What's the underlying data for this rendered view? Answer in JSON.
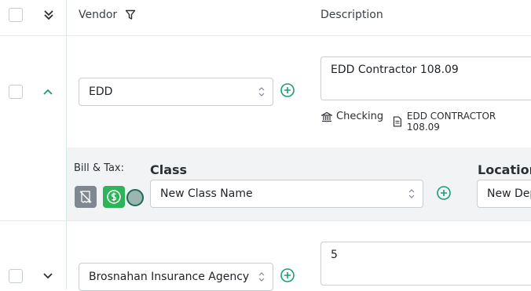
{
  "header": {
    "vendor_label": "Vendor",
    "description_label": "Description"
  },
  "rows": [
    {
      "vendor": "EDD",
      "description": "EDD Contractor 108.09",
      "account": "Checking",
      "memo": "EDD CONTRACTOR 108.09",
      "expanded": true
    },
    {
      "vendor": "Brosnahan Insurance Agency",
      "description": "5",
      "expanded": false
    }
  ],
  "detail": {
    "bill_tax_label": "Bill & Tax:",
    "class_label": "Class",
    "class_value": "New Class Name",
    "location_label": "Location",
    "location_value": "New Dep"
  },
  "colors": {
    "accent": "#1a9c7a",
    "green_badge": "#2fb35a",
    "grey_badge": "#7f8790"
  },
  "icons": {
    "collapse_all": "double-chevron-down-icon",
    "filter": "filter-icon",
    "bank": "bank-icon",
    "document": "document-icon",
    "dollar": "dollar-icon",
    "no_receipt": "no-receipt-icon"
  }
}
